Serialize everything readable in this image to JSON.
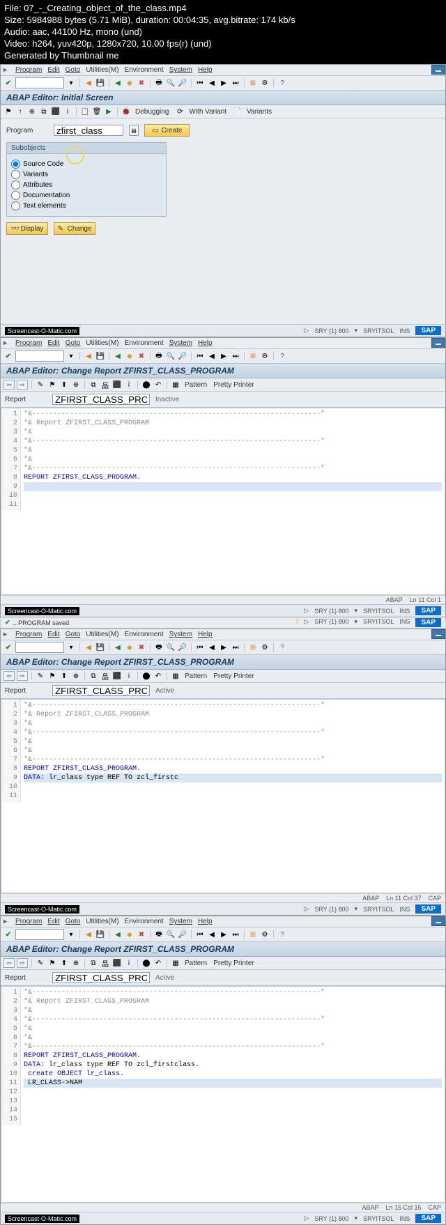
{
  "header": {
    "file": "File: 07_-_Creating_object_of_the_class.mp4",
    "size": "Size: 5984988 bytes (5.71 MiB), duration: 00:04:35, avg.bitrate: 174 kb/s",
    "audio": "Audio: aac, 44100 Hz, mono (und)",
    "video": "Video: h264, yuv420p, 1280x720, 10.00 fps(r) (und)",
    "gen": "Generated by Thumbnail me"
  },
  "menu": {
    "program": "Program",
    "edit": "Edit",
    "goto": "Goto",
    "util": "Utilities(M)",
    "env": "Environment",
    "sys": "System",
    "help": "Help"
  },
  "frame1": {
    "title": "ABAP Editor: Initial Screen",
    "debug": "Debugging",
    "withvar": "With Variant",
    "variants": "Variants",
    "programLabel": "Program",
    "programValue": "zfirst_class",
    "create": "Create",
    "subobjects": "Subobjects",
    "r1": "Source Code",
    "r2": "Variants",
    "r3": "Attributes",
    "r4": "Documentation",
    "r5": "Text elements",
    "display": "Display",
    "change": "Change"
  },
  "status": {
    "sry": "SRY (1) 800",
    "host": "SRYITSOL",
    "ins": "INS",
    "cap": "CAP",
    "sap": "SAP",
    "som": "Screencast-O-Matic.com",
    "abap": "ABAP",
    "ln11c1": "Ln  11 Col  1",
    "ln11c37": "Ln  11 Col  37",
    "ln15c15": "Ln  15 Col  15",
    "saved": "PROGRAM saved"
  },
  "editor": {
    "title": "ABAP Editor: Change Report ZFIRST_CLASS_PROGRAM",
    "pattern": "Pattern",
    "pretty": "Pretty Printer",
    "reportLbl": "Report",
    "reportVal": "ZFIRST_CLASS_PROGRAM",
    "inactive": "Inactive",
    "active": "Active",
    "starline": "*&---------------------------------------------------------------------*",
    "repcomment": "*& Report  ZFIRST_CLASS_PROGRAM",
    "blank": "*&",
    "reportstmt": "REPORT  ZFIRST_CLASS_PROGRAM.",
    "data_partial": "lr_class type REF TO zcl_firstc",
    "data_full": "lr_class type REF TO zcl_firstclass.",
    "create_obj": "create OBJECT lr_class.",
    "lr_name": "LR_CLASS->NAM",
    "kw_data": "DATA:",
    "blank_line": ""
  }
}
